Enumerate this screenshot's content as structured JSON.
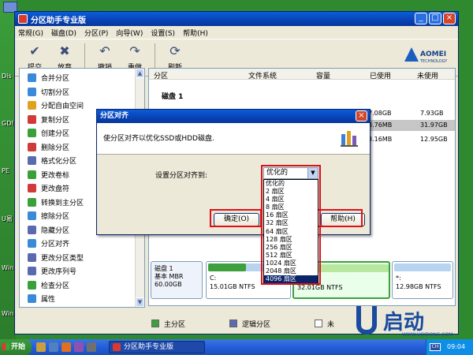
{
  "desktop": {
    "side_labels": [
      "Dis",
      "GDI",
      "PE",
      "U易",
      "Win",
      "Win"
    ]
  },
  "window": {
    "title": "分区助手专业版",
    "minimize": "_",
    "maximize": "□",
    "close": "×"
  },
  "menu": [
    "常规(G)",
    "磁盘(D)",
    "分区(P)",
    "向导(W)",
    "设置(S)",
    "帮助(H)"
  ],
  "toolbar": {
    "buttons": [
      {
        "label": "提交",
        "icon": "check-icon",
        "glyph": "✔"
      },
      {
        "label": "放弃",
        "icon": "discard-icon",
        "glyph": "✖"
      },
      {
        "label": "撤销",
        "icon": "undo-icon",
        "glyph": "↶"
      },
      {
        "label": "重做",
        "icon": "redo-icon",
        "glyph": "↷"
      },
      {
        "label": "刷新",
        "icon": "refresh-icon",
        "glyph": "⟳"
      }
    ],
    "logo_name": "AOMEI",
    "logo_sub": "TECHNOLOGY"
  },
  "operations": [
    {
      "label": "合并分区",
      "color": "#3a8ad8"
    },
    {
      "label": "切割分区",
      "color": "#3a8ad8"
    },
    {
      "label": "分配自由空间",
      "color": "#e0a020"
    },
    {
      "label": "复制分区",
      "color": "#d03a3a"
    },
    {
      "label": "创建分区",
      "color": "#3aa03a"
    },
    {
      "label": "删除分区",
      "color": "#d03a3a"
    },
    {
      "label": "格式化分区",
      "color": "#5a6ab0"
    },
    {
      "label": "更改卷标",
      "color": "#3aa03a"
    },
    {
      "label": "更改盘符",
      "color": "#d03a3a"
    },
    {
      "label": "转换到主分区",
      "color": "#3aa03a"
    },
    {
      "label": "擦除分区",
      "color": "#3a8ad8"
    },
    {
      "label": "隐藏分区",
      "color": "#5a6ab0"
    },
    {
      "label": "分区对齐",
      "color": "#3a8ad8"
    },
    {
      "label": "更改分区类型",
      "color": "#5a6ab0"
    },
    {
      "label": "更改序列号",
      "color": "#5a6ab0"
    },
    {
      "label": "检查分区",
      "color": "#3aa03a"
    },
    {
      "label": "属性",
      "color": "#3a8ad8"
    }
  ],
  "partition_table": {
    "headers": {
      "partition": "分区",
      "fs": "文件系统",
      "capacity": "容量",
      "used": "已使用",
      "unused": "未使用"
    },
    "disk_label": "磁盘 1",
    "rows": [
      {
        "used": "7.08GB",
        "unused": "7.93GB"
      },
      {
        "used": "3.76MB",
        "unused": "31.97GB"
      },
      {
        "used": "3.16MB",
        "unused": "12.95GB"
      }
    ]
  },
  "disk_map": {
    "disk_name": "磁盘 1",
    "disk_type": "基本 MBR",
    "disk_size": "60.00GB",
    "partitions": [
      {
        "letter": "C:",
        "info": "15.01GB NTFS",
        "used_fraction": 0.47
      },
      {
        "letter": "",
        "info": "32.01GB NTFS",
        "used_fraction": 0.0
      },
      {
        "letter": "*:",
        "info": "12.98GB NTFS",
        "used_fraction": 0.0
      }
    ]
  },
  "legend": {
    "primary": "主分区",
    "logical": "逻辑分区",
    "unallocated": "未"
  },
  "dialog": {
    "title": "分区对齐",
    "description": "使分区对齐以优化SSD或HDD磁盘.",
    "field_label": "设置分区对齐到:",
    "selected_value": "优化的",
    "ok_label": "确定(O)",
    "help_label": "帮助(H)",
    "close": "×",
    "options": [
      "优化的",
      "2 扇区",
      "4 扇区",
      "8 扇区",
      "16 扇区",
      "32 扇区",
      "64 扇区",
      "128 扇区",
      "256 扇区",
      "512 扇区",
      "1024 扇区",
      "2048 扇区",
      "4096 扇区"
    ],
    "highlighted_option": "4096 扇区"
  },
  "taskbar": {
    "start": "开始",
    "task": "分区助手专业版",
    "lang": "CH",
    "clock": "09:04"
  },
  "brand": {
    "text": "启动",
    "url": "WWW.UQIDONG.COM"
  }
}
